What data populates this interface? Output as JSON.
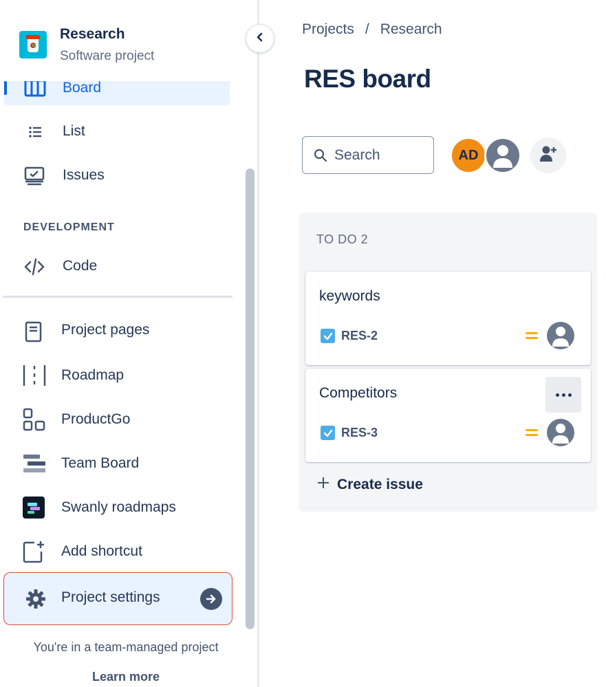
{
  "project": {
    "name": "Research",
    "type": "Software project"
  },
  "sidebar": {
    "collapse_icon": "chevron-left-icon",
    "items": [
      {
        "label": "Board",
        "icon": "board-icon",
        "active": true
      },
      {
        "label": "List",
        "icon": "list-icon"
      },
      {
        "label": "Issues",
        "icon": "issues-icon"
      }
    ],
    "development_title": "DEVELOPMENT",
    "dev_items": [
      {
        "label": "Code",
        "icon": "code-icon"
      }
    ],
    "shortcut_items": [
      {
        "label": "Project pages",
        "icon": "page-icon"
      },
      {
        "label": "Roadmap",
        "icon": "roadmap-icon"
      },
      {
        "label": "ProductGo",
        "icon": "productgo-icon"
      },
      {
        "label": "Team Board",
        "icon": "team-board-icon"
      },
      {
        "label": "Swanly roadmaps",
        "icon": "swanly-icon"
      },
      {
        "label": "Add shortcut",
        "icon": "add-shortcut-icon"
      }
    ],
    "settings": {
      "label": "Project settings",
      "icon": "gear-icon"
    },
    "footer_text": "You're in a team-managed project",
    "footer_link": "Learn more"
  },
  "main": {
    "breadcrumb": [
      "Projects",
      "/",
      "Research"
    ],
    "title": "RES board",
    "search_placeholder": "Search",
    "avatar_initials": "AD",
    "column": {
      "title": "TO DO 2",
      "cards": [
        {
          "summary": "keywords",
          "key": "RES-2"
        },
        {
          "summary": "Competitors",
          "key": "RES-3"
        }
      ],
      "create_label": "Create issue"
    }
  },
  "colors": {
    "accent": "#0c66e4",
    "highlight_border": "#e34935",
    "avatar_orange": "#f18d13",
    "priority_medium": "#ffab00",
    "task_blue": "#4bade8"
  }
}
